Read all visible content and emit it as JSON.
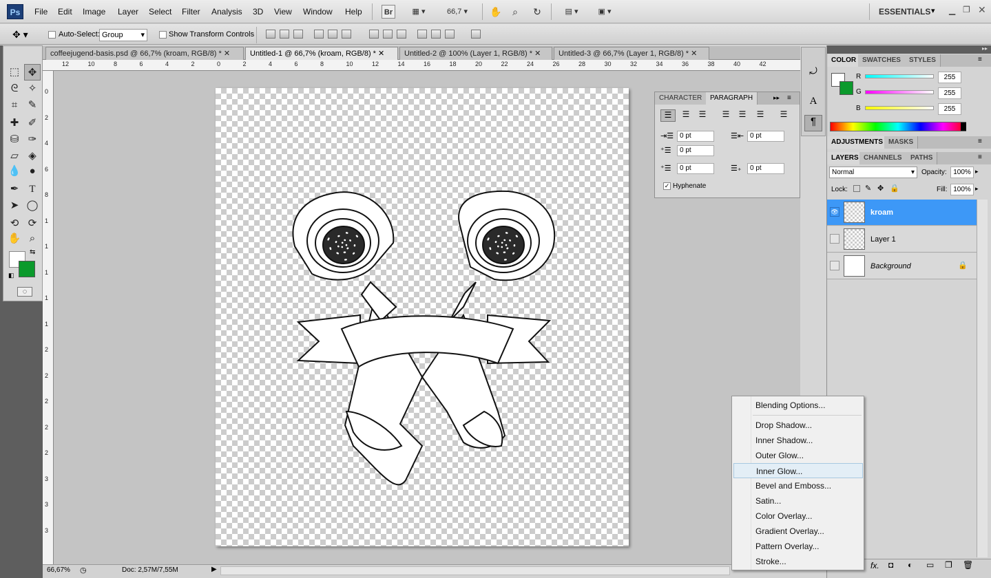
{
  "app": {
    "logo": "Ps",
    "workspace": "ESSENTIALS"
  },
  "menu": [
    "File",
    "Edit",
    "Image",
    "Layer",
    "Select",
    "Filter",
    "Analysis",
    "3D",
    "View",
    "Window",
    "Help"
  ],
  "menubar": {
    "bridge": "Br",
    "zoom": "66,7"
  },
  "options": {
    "auto_select_label": "Auto-Select:",
    "auto_select_value": "Group",
    "transform_label": "Show Transform Controls"
  },
  "tabs": [
    "coffeejugend-basis.psd @ 66,7% (kroam, RGB/8) *",
    "Untitled-1 @ 66,7% (kroam, RGB/8) *",
    "Untitled-2 @ 100% (Layer 1, RGB/8) *",
    "Untitled-3 @ 66,7% (Layer 1, RGB/8) *"
  ],
  "ruler_top": [
    "12",
    "10",
    "8",
    "6",
    "4",
    "2",
    "0",
    "2",
    "4",
    "6",
    "8",
    "10",
    "12",
    "14",
    "16",
    "18",
    "20",
    "22",
    "24",
    "26",
    "28",
    "30",
    "32",
    "34",
    "36",
    "38",
    "40",
    "42"
  ],
  "ruler_left": [
    "0",
    "2",
    "4",
    "6",
    "8",
    "1",
    "1",
    "1",
    "1",
    "1",
    "2",
    "2",
    "2",
    "2",
    "2",
    "3",
    "3",
    "3"
  ],
  "status": {
    "zoom": "66,67%",
    "doc": "Doc: 2,57M/7,55M"
  },
  "paragraph": {
    "tabs": [
      "CHARACTER",
      "PARAGRAPH"
    ],
    "indent_left": "0 pt",
    "indent_right": "0 pt",
    "first_line": "0 pt",
    "space_before": "0 pt",
    "space_after": "0 pt",
    "hyphenate": "Hyphenate"
  },
  "color_panel": {
    "tabs": [
      "COLOR",
      "SWATCHES",
      "STYLES"
    ],
    "r_label": "R",
    "g_label": "G",
    "b_label": "B",
    "r": "255",
    "g": "255",
    "b": "255"
  },
  "adjust_tabs": [
    "ADJUSTMENTS",
    "MASKS"
  ],
  "layers_panel": {
    "tabs": [
      "LAYERS",
      "CHANNELS",
      "PATHS"
    ],
    "blend_mode": "Normal",
    "opacity_label": "Opacity:",
    "opacity": "100%",
    "lock_label": "Lock:",
    "fill_label": "Fill:",
    "fill": "100%",
    "layers": [
      "kroam",
      "Layer 1",
      "Background"
    ]
  },
  "context_menu": [
    "Blending Options...",
    "Drop Shadow...",
    "Inner Shadow...",
    "Outer Glow...",
    "Inner Glow...",
    "Bevel and Emboss...",
    "Satin...",
    "Color Overlay...",
    "Gradient Overlay...",
    "Pattern Overlay...",
    "Stroke..."
  ],
  "colors": {
    "foreground": "#ffffff",
    "background": "#0b9a2c",
    "selection": "#3d98f7"
  }
}
